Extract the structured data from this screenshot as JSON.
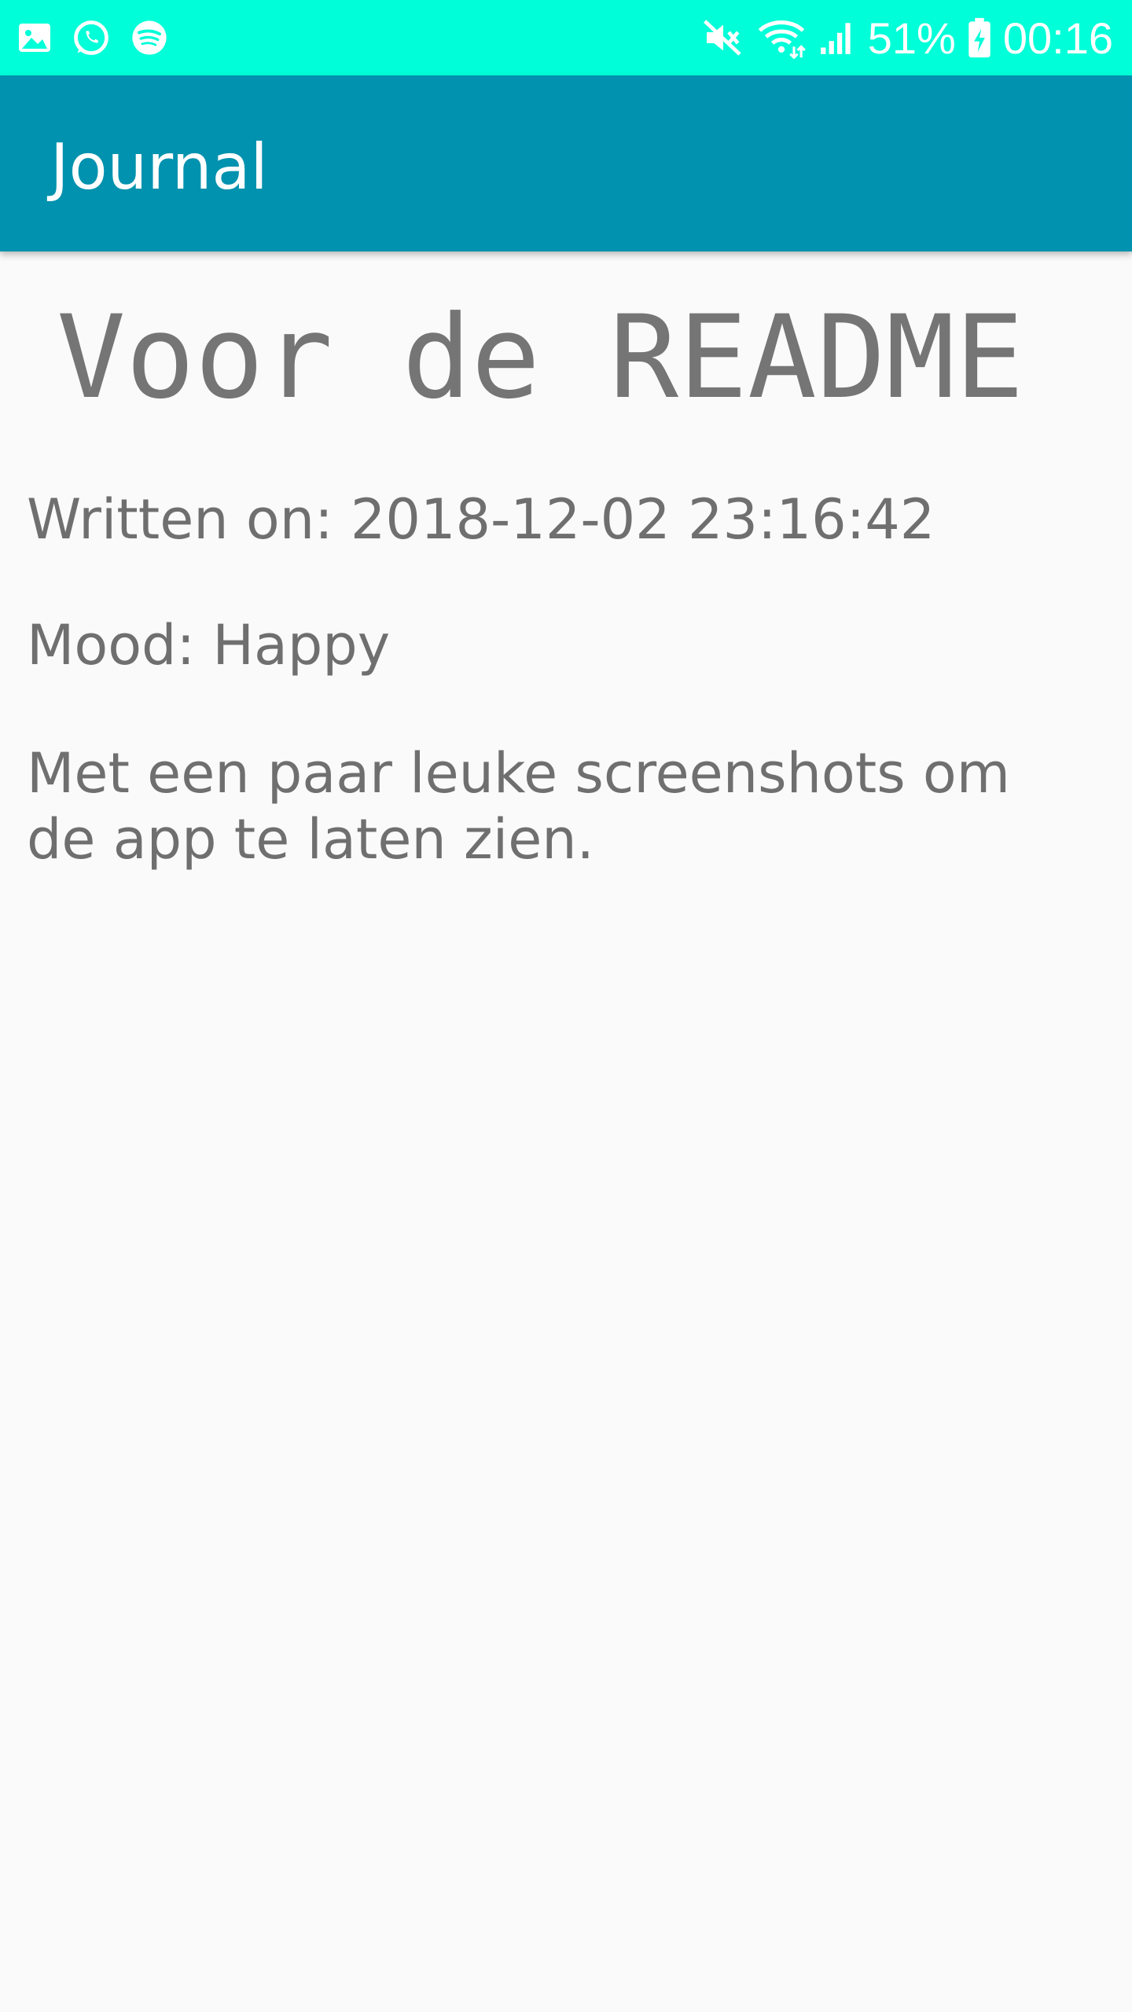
{
  "status_bar": {
    "left_icons": [
      "gallery-icon",
      "whatsapp-icon",
      "spotify-icon"
    ],
    "right_icons": [
      "mute-icon",
      "wifi-icon",
      "signal-icon",
      "battery-icon"
    ],
    "battery_percent": "51%",
    "time": "00:16",
    "background_color": "#00ffd8"
  },
  "app_bar": {
    "title": "Journal",
    "background_color": "#0092ae"
  },
  "entry": {
    "title": "Voor de README",
    "written_on": "Written on: 2018-12-02 23:16:42",
    "mood": "Mood: Happy",
    "content": "Met een paar leuke screenshots om de app te laten zien."
  }
}
